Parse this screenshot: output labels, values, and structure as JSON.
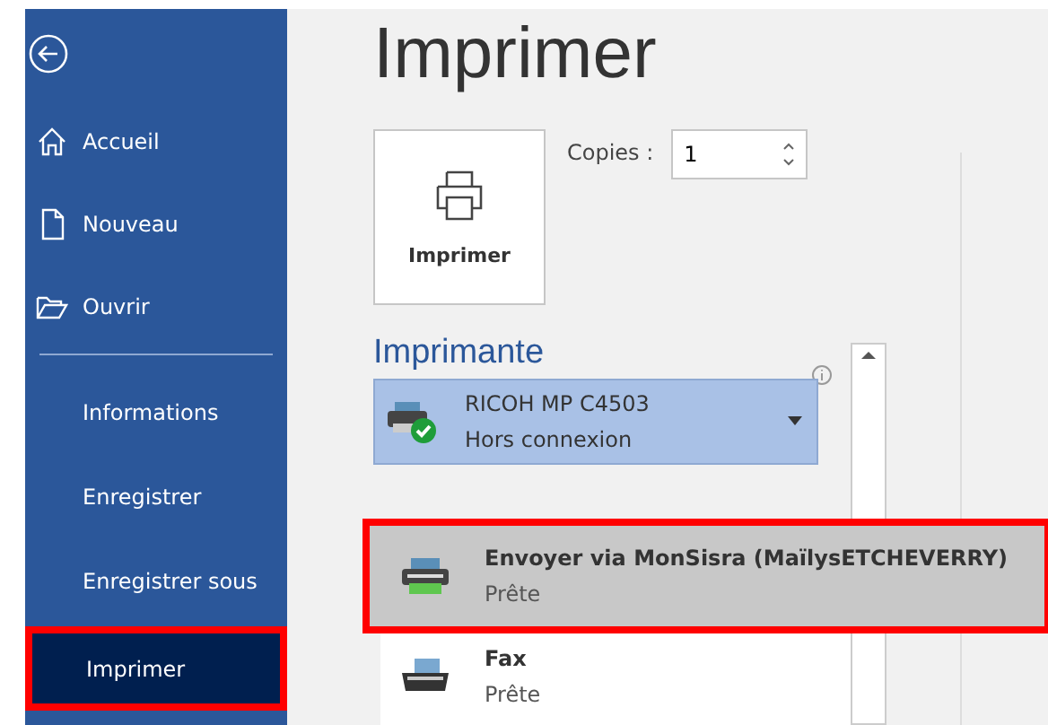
{
  "sidebar": {
    "top_items": [
      {
        "label": "Accueil"
      },
      {
        "label": "Nouveau"
      },
      {
        "label": "Ouvrir"
      }
    ],
    "items": [
      {
        "label": "Informations",
        "selected": false
      },
      {
        "label": "Enregistrer",
        "selected": false
      },
      {
        "label": "Enregistrer sous",
        "selected": false
      },
      {
        "label": "Imprimer",
        "selected": true
      }
    ]
  },
  "title": "Imprimer",
  "print_button": {
    "label": "Imprimer"
  },
  "copies": {
    "label": "Copies :",
    "value": "1"
  },
  "printer": {
    "heading": "Imprimante",
    "current": {
      "name": "RICOH MP C4503",
      "status": "Hors connexion"
    },
    "options": [
      {
        "name": "Envoyer via MonSisra (MaïlysETCHEVERRY)",
        "status": "Prête",
        "kind": "send",
        "selected": true
      },
      {
        "name": "Fax",
        "status": "Prête",
        "kind": "fax",
        "selected": false
      }
    ]
  }
}
